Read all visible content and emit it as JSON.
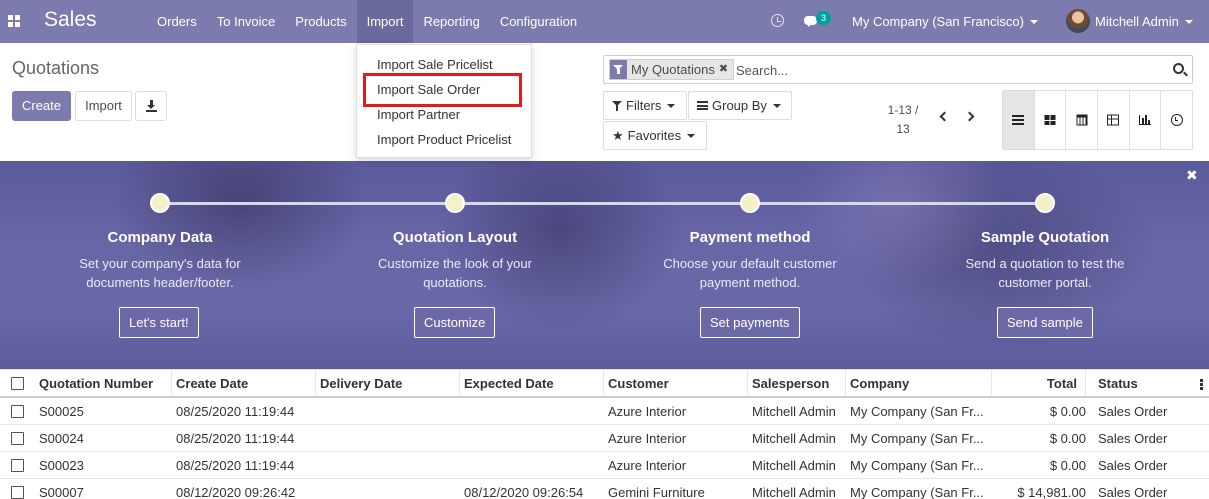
{
  "navbar": {
    "app_name": "Sales",
    "menu": [
      "Orders",
      "To Invoice",
      "Products",
      "Import",
      "Reporting",
      "Configuration"
    ],
    "open_menu": "Import",
    "chat_count": "3",
    "company": "My Company (San Francisco)",
    "user": "Mitchell Admin"
  },
  "control_panel": {
    "breadcrumb": "Quotations",
    "create_label": "Create",
    "import_label": "Import",
    "download_icon": "download-icon",
    "search": {
      "facet_label": "My Quotations",
      "facet_remove": "✖",
      "placeholder": "Search..."
    },
    "filters_label": "Filters",
    "groupby_label": "Group By",
    "favorites_label": "Favorites",
    "pager_value": "1-13 / 13",
    "views": [
      "list-view-icon",
      "kanban-view-icon",
      "calendar-view-icon",
      "pivot-view-icon",
      "graph-view-icon",
      "activity-view-icon"
    ],
    "active_view": "list-view-icon"
  },
  "import_dropdown": {
    "items": [
      "Import Sale Pricelist",
      "Import Sale Order",
      "Import Partner",
      "Import Product Pricelist"
    ],
    "highlighted": "Import Sale Order",
    "highlight_color": "#e31b1b"
  },
  "onboarding": {
    "close_symbol": "✖",
    "steps": [
      {
        "title": "Company Data",
        "desc": "Set your company's data for documents header/footer.",
        "button": "Let's start!"
      },
      {
        "title": "Quotation Layout",
        "desc": "Customize the look of your quotations.",
        "button": "Customize"
      },
      {
        "title": "Payment method",
        "desc": "Choose your default customer payment method.",
        "button": "Set payments"
      },
      {
        "title": "Sample Quotation",
        "desc": "Send a quotation to test the customer portal.",
        "button": "Send sample"
      }
    ]
  },
  "table": {
    "columns": [
      "Quotation Number",
      "Create Date",
      "Delivery Date",
      "Expected Date",
      "Customer",
      "Salesperson",
      "Company",
      "Total",
      "Status"
    ],
    "rows": [
      [
        "S00025",
        "08/25/2020 11:19:44",
        "",
        "",
        "Azure Interior",
        "Mitchell Admin",
        "My Company (San Fr...",
        "$ 0.00",
        "Sales Order"
      ],
      [
        "S00024",
        "08/25/2020 11:19:44",
        "",
        "",
        "Azure Interior",
        "Mitchell Admin",
        "My Company (San Fr...",
        "$ 0.00",
        "Sales Order"
      ],
      [
        "S00023",
        "08/25/2020 11:19:44",
        "",
        "",
        "Azure Interior",
        "Mitchell Admin",
        "My Company (San Fr...",
        "$ 0.00",
        "Sales Order"
      ],
      [
        "S00007",
        "08/12/2020 09:26:42",
        "",
        "08/12/2020 09:26:54",
        "Gemini Furniture",
        "Mitchell Admin",
        "My Company (San Fr...",
        "$ 14,981.00",
        "Sales Order"
      ]
    ]
  },
  "colors": {
    "brand": "#7c7bad",
    "badge": "#00a09d"
  }
}
